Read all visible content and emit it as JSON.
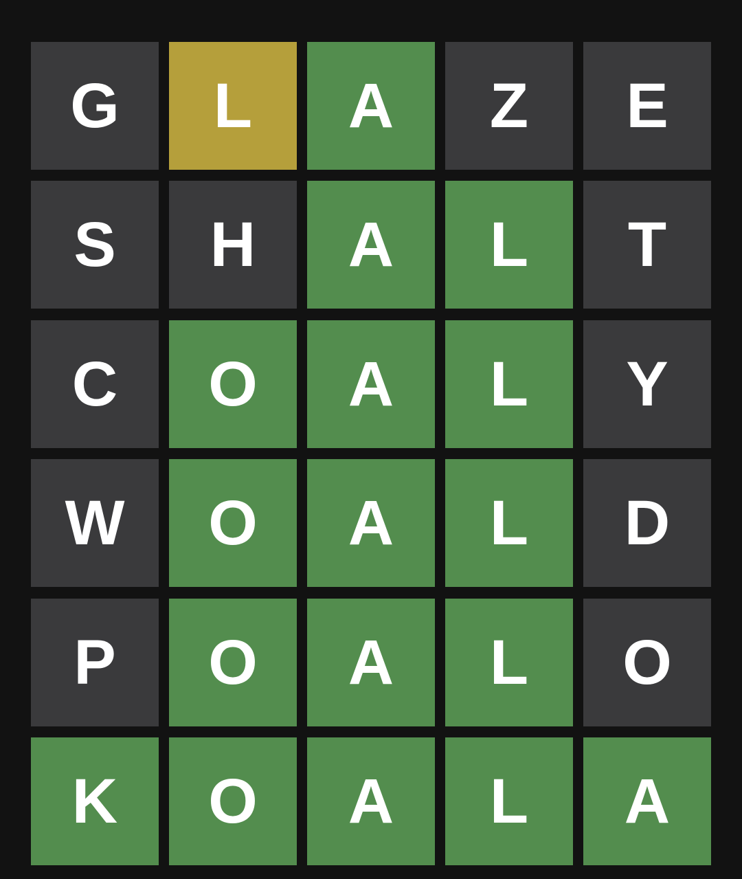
{
  "board": {
    "rows": [
      {
        "tiles": [
          {
            "letter": "G",
            "state": "absent"
          },
          {
            "letter": "L",
            "state": "present"
          },
          {
            "letter": "A",
            "state": "correct"
          },
          {
            "letter": "Z",
            "state": "absent"
          },
          {
            "letter": "E",
            "state": "absent"
          }
        ]
      },
      {
        "tiles": [
          {
            "letter": "S",
            "state": "absent"
          },
          {
            "letter": "H",
            "state": "absent"
          },
          {
            "letter": "A",
            "state": "correct"
          },
          {
            "letter": "L",
            "state": "correct"
          },
          {
            "letter": "T",
            "state": "absent"
          }
        ]
      },
      {
        "tiles": [
          {
            "letter": "C",
            "state": "absent"
          },
          {
            "letter": "O",
            "state": "correct"
          },
          {
            "letter": "A",
            "state": "correct"
          },
          {
            "letter": "L",
            "state": "correct"
          },
          {
            "letter": "Y",
            "state": "absent"
          }
        ]
      },
      {
        "tiles": [
          {
            "letter": "W",
            "state": "absent"
          },
          {
            "letter": "O",
            "state": "correct"
          },
          {
            "letter": "A",
            "state": "correct"
          },
          {
            "letter": "L",
            "state": "correct"
          },
          {
            "letter": "D",
            "state": "absent"
          }
        ]
      },
      {
        "tiles": [
          {
            "letter": "P",
            "state": "absent"
          },
          {
            "letter": "O",
            "state": "correct"
          },
          {
            "letter": "A",
            "state": "correct"
          },
          {
            "letter": "L",
            "state": "correct"
          },
          {
            "letter": "O",
            "state": "absent"
          }
        ]
      },
      {
        "tiles": [
          {
            "letter": "K",
            "state": "correct"
          },
          {
            "letter": "O",
            "state": "correct"
          },
          {
            "letter": "A",
            "state": "correct"
          },
          {
            "letter": "L",
            "state": "correct"
          },
          {
            "letter": "A",
            "state": "correct"
          }
        ]
      }
    ]
  },
  "colors": {
    "background": "#121212",
    "absent": "#3a3a3c",
    "present": "#b59f3b",
    "correct": "#538d4e",
    "letter": "#ffffff"
  }
}
